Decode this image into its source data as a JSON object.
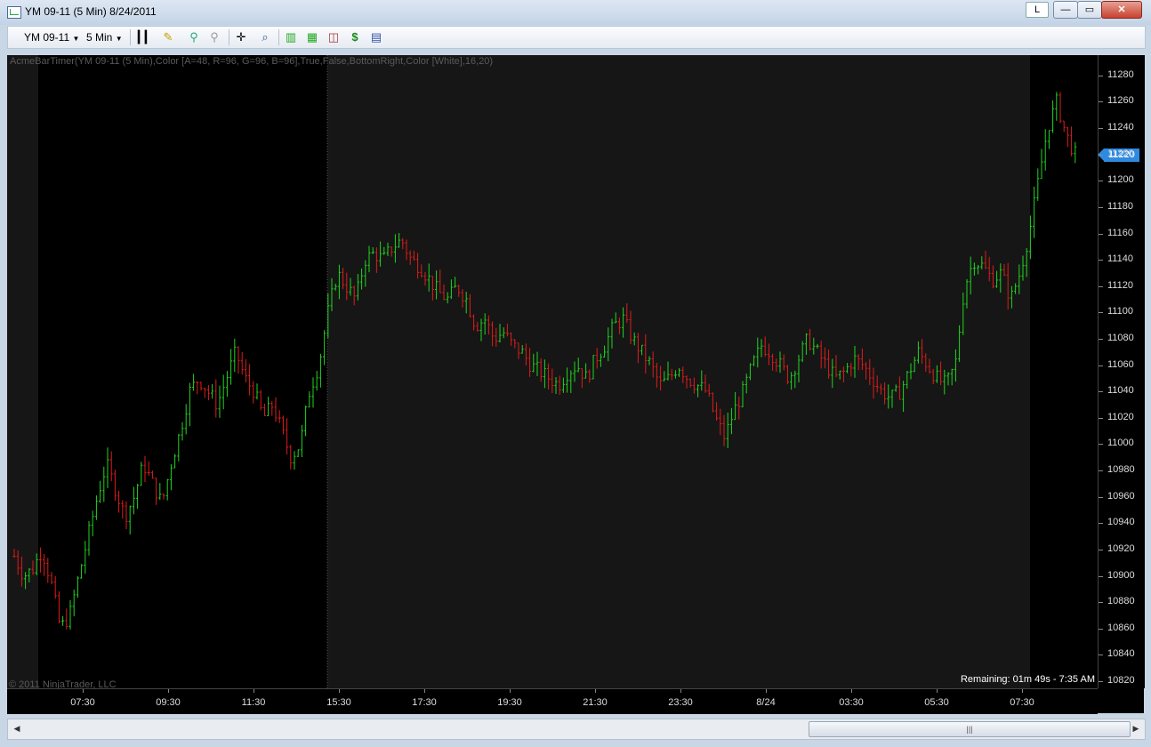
{
  "window": {
    "title": "YM 09-11 (5 Min)  8/24/2011",
    "lang_badge": "L",
    "min_glyph": "—",
    "max_glyph": "▭",
    "close_glyph": "✕"
  },
  "toolbar": {
    "instrument": "YM 09-11",
    "interval": "5 Min",
    "icons": [
      "bar-type-icon",
      "pencil-icon",
      "pin-icon",
      "pin-gray-icon",
      "crosshair-icon",
      "zoom-icon",
      "strategy-icon",
      "indicators-icon",
      "chart-trader-icon",
      "dollar-icon",
      "properties-icon"
    ]
  },
  "chart": {
    "indicator_label": "AcmeBarTimer(YM 09-11 (5 Min),Color [A=48, R=96, G=96, B=96],True,False,BottomRight,Color [White],16,20)",
    "copyright": "© 2011 NinjaTrader, LLC",
    "remaining": "Remaining: 01m 49s - 7:35 AM",
    "current_price": "11220",
    "colors": {
      "up": "#1fd51f",
      "down": "#e01b1b",
      "session_bg": "#161616",
      "bg": "#000000"
    }
  },
  "chart_data": {
    "type": "ohlc",
    "ylim": [
      10820,
      11290
    ],
    "price_ticks": [
      "11280",
      "11260",
      "11240",
      "11220",
      "11200",
      "11180",
      "11160",
      "11140",
      "11120",
      "11100",
      "11080",
      "11060",
      "11040",
      "11020",
      "11000",
      "10980",
      "10960",
      "10940",
      "10920",
      "10900",
      "10880",
      "10860",
      "10840",
      "10820"
    ],
    "time_ticks": [
      "07:30",
      "09:30",
      "11:30",
      "15:30",
      "17:30",
      "19:30",
      "21:30",
      "23:30",
      "8/24",
      "03:30",
      "05:30",
      "07:30"
    ],
    "current_price": 11220,
    "close_path": [
      10915,
      10900,
      10905,
      10920,
      10895,
      10860,
      10870,
      10900,
      10930,
      10960,
      10985,
      10965,
      10945,
      10960,
      10985,
      10970,
      10955,
      10985,
      11010,
      11040,
      11050,
      11040,
      11030,
      11050,
      11070,
      11050,
      11040,
      11020,
      11030,
      11010,
      10990,
      11000,
      11040,
      11060,
      11100,
      11130,
      11120,
      11110,
      11140,
      11145,
      11140,
      11150,
      11155,
      11140,
      11135,
      11125,
      11115,
      11110,
      11120,
      11110,
      11090,
      11095,
      11080,
      11085,
      11075,
      11070,
      11060,
      11055,
      11050,
      11045,
      11055,
      11060,
      11050,
      11065,
      11075,
      11090,
      11095,
      11080,
      11070,
      11060,
      11045,
      11050,
      11060,
      11050,
      11045,
      11040,
      11020,
      11005,
      11025,
      11040,
      11060,
      11075,
      11070,
      11060,
      11050,
      11065,
      11080,
      11070,
      11060,
      11050,
      11055,
      11065,
      11060,
      11050,
      11040,
      11035,
      11040,
      11055,
      11070,
      11060,
      11050,
      11045,
      11060,
      11120,
      11140,
      11135,
      11125,
      11130,
      11110,
      11130,
      11160,
      11200,
      11240,
      11260,
      11235,
      11220
    ]
  }
}
